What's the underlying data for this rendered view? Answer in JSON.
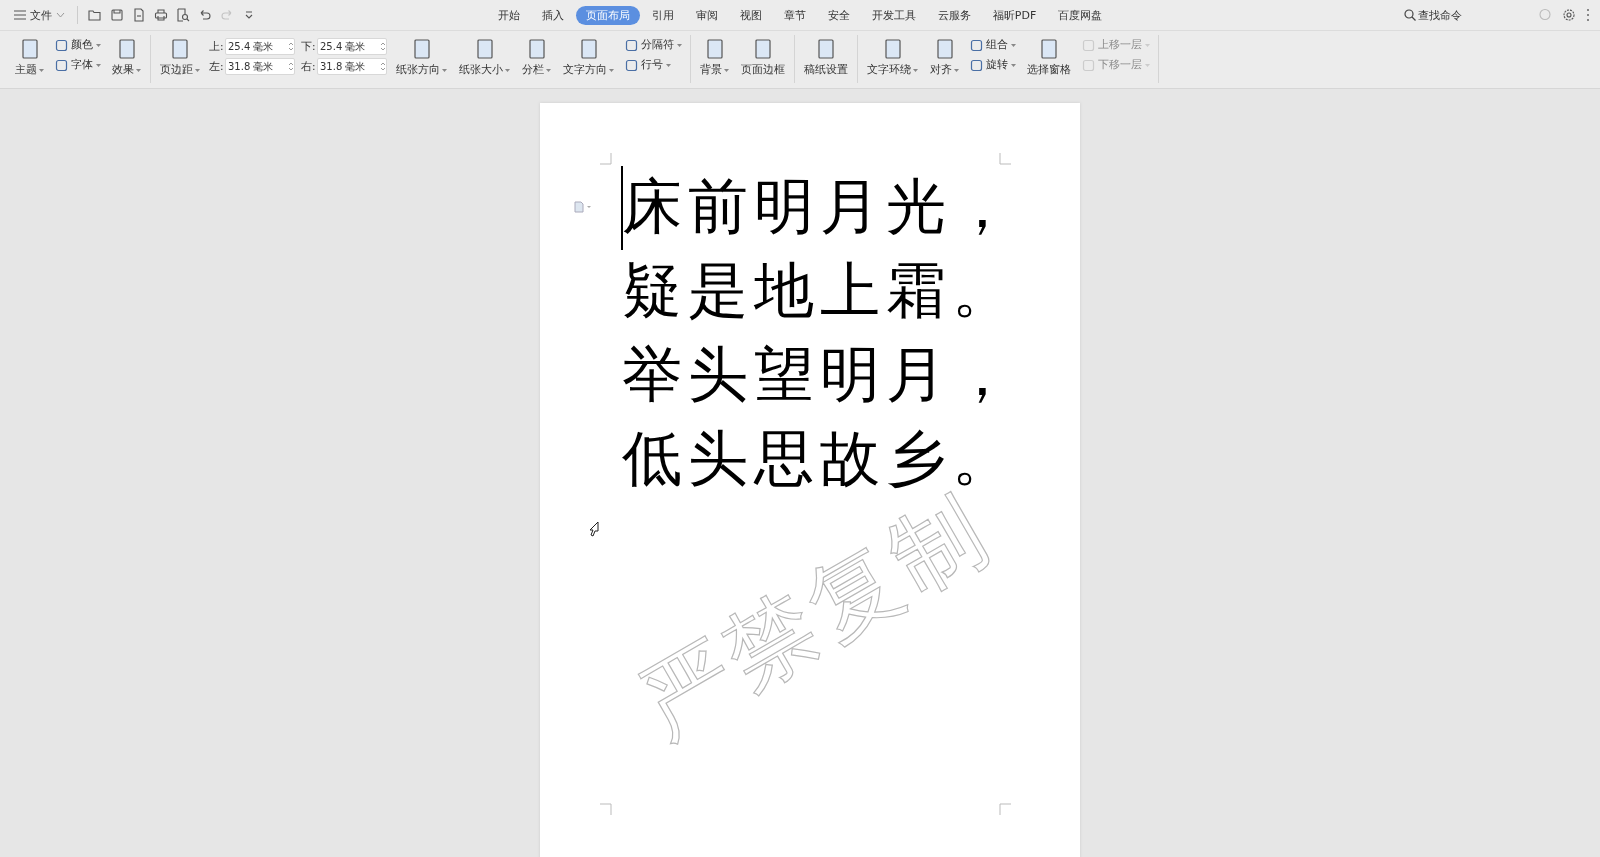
{
  "file_menu": {
    "label": "文件"
  },
  "tabs": [
    {
      "label": "开始",
      "selected": false
    },
    {
      "label": "插入",
      "selected": false
    },
    {
      "label": "页面布局",
      "selected": true
    },
    {
      "label": "引用",
      "selected": false
    },
    {
      "label": "审阅",
      "selected": false
    },
    {
      "label": "视图",
      "selected": false
    },
    {
      "label": "章节",
      "selected": false
    },
    {
      "label": "安全",
      "selected": false
    },
    {
      "label": "开发工具",
      "selected": false
    },
    {
      "label": "云服务",
      "selected": false
    },
    {
      "label": "福昕PDF",
      "selected": false
    },
    {
      "label": "百度网盘",
      "selected": false
    }
  ],
  "search": {
    "label": "查找命令"
  },
  "ribbon": {
    "groups": [
      {
        "items": [
          {
            "kind": "large",
            "label": "主题",
            "dropdown": true
          },
          {
            "kind": "stack",
            "rows": [
              {
                "label": "颜色",
                "dropdown": true,
                "disabled": false
              },
              {
                "label": "字体",
                "dropdown": true,
                "disabled": false
              }
            ]
          },
          {
            "kind": "large",
            "label": "效果",
            "dropdown": true
          }
        ]
      },
      {
        "items": [
          {
            "kind": "large",
            "label": "页边距",
            "dropdown": true
          },
          {
            "kind": "fields",
            "rows": [
              {
                "label": "上:",
                "value": "25.4 毫米"
              },
              {
                "label": "左:",
                "value": "31.8 毫米"
              }
            ]
          },
          {
            "kind": "fields",
            "rows": [
              {
                "label": "下:",
                "value": "25.4 毫米"
              },
              {
                "label": "右:",
                "value": "31.8 毫米"
              }
            ]
          },
          {
            "kind": "large",
            "label": "纸张方向",
            "dropdown": true
          },
          {
            "kind": "large",
            "label": "纸张大小",
            "dropdown": true
          },
          {
            "kind": "large",
            "label": "分栏",
            "dropdown": true
          },
          {
            "kind": "large",
            "label": "文字方向",
            "dropdown": true
          },
          {
            "kind": "stack",
            "rows": [
              {
                "label": "分隔符",
                "dropdown": true,
                "disabled": false
              },
              {
                "label": "行号",
                "dropdown": true,
                "disabled": false
              }
            ]
          }
        ]
      },
      {
        "items": [
          {
            "kind": "large",
            "label": "背景",
            "dropdown": true
          },
          {
            "kind": "large",
            "label": "页面边框",
            "dropdown": false
          }
        ]
      },
      {
        "items": [
          {
            "kind": "large",
            "label": "稿纸设置",
            "dropdown": false
          }
        ]
      },
      {
        "items": [
          {
            "kind": "large",
            "label": "文字环绕",
            "dropdown": true
          },
          {
            "kind": "large",
            "label": "对齐",
            "dropdown": true
          },
          {
            "kind": "stack",
            "rows": [
              {
                "label": "组合",
                "dropdown": true,
                "disabled": false
              },
              {
                "label": "旋转",
                "dropdown": true,
                "disabled": false
              }
            ]
          },
          {
            "kind": "large",
            "label": "选择窗格",
            "dropdown": false
          },
          {
            "kind": "stack",
            "rows": [
              {
                "label": "上移一层",
                "dropdown": true,
                "disabled": true
              },
              {
                "label": "下移一层",
                "dropdown": true,
                "disabled": true
              }
            ]
          }
        ]
      }
    ]
  },
  "document": {
    "lines": [
      "床前明月光，",
      "疑是地上霜。",
      "举头望明月，",
      "低头思故乡。"
    ],
    "watermark": "严禁复制"
  }
}
